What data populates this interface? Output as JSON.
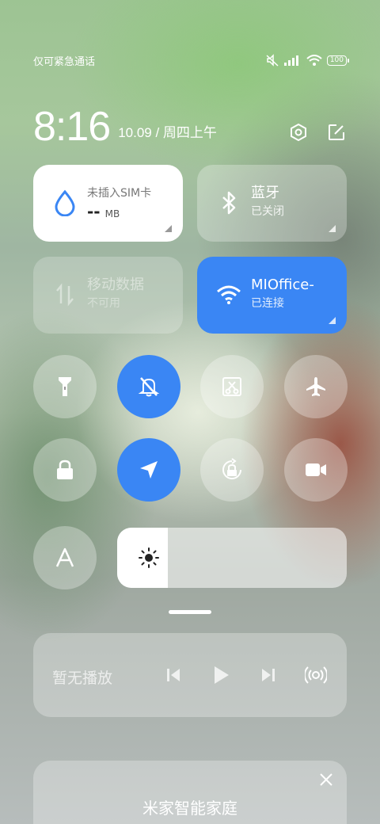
{
  "status_bar": {
    "carrier_text": "仅可紧急通话",
    "battery": "100",
    "icons": [
      "mute-icon",
      "signal-icon",
      "wifi-icon",
      "battery-icon"
    ]
  },
  "clock": {
    "time": "8:16",
    "date": "10.09 / 周四上午",
    "actions": [
      "settings-icon",
      "edit-icon"
    ]
  },
  "tiles": {
    "data_usage": {
      "label": "未插入SIM卡",
      "value": "--",
      "unit": "MB",
      "icon": "water-drop-icon",
      "accent": "#3a86f4"
    },
    "bluetooth": {
      "label": "蓝牙",
      "status": "已关闭",
      "icon": "bluetooth-icon"
    },
    "mobile_data": {
      "label": "移动数据",
      "status": "不可用",
      "icon": "arrows-updown-icon"
    },
    "wifi": {
      "label": "MIOffice-",
      "status": "已连接",
      "icon": "wifi-icon",
      "color": "#3a86f4"
    }
  },
  "toggles": [
    {
      "name": "flashlight",
      "icon": "flashlight-icon",
      "active": false
    },
    {
      "name": "silent",
      "icon": "bell-off-icon",
      "active": true
    },
    {
      "name": "screenshot",
      "icon": "screenshot-icon",
      "active": false
    },
    {
      "name": "airplane",
      "icon": "airplane-icon",
      "active": false
    },
    {
      "name": "lock",
      "icon": "lock-icon",
      "active": false
    },
    {
      "name": "location",
      "icon": "location-icon",
      "active": true
    },
    {
      "name": "rotation-lock",
      "icon": "rotation-lock-icon",
      "active": false
    },
    {
      "name": "screen-recorder",
      "icon": "video-camera-icon",
      "active": false
    },
    {
      "name": "font",
      "icon": "font-a-icon",
      "active": false
    }
  ],
  "brightness": {
    "level": 0.22,
    "icon": "sun-icon"
  },
  "media": {
    "title": "暂无播放",
    "controls": [
      "previous-icon",
      "play-icon",
      "next-icon",
      "cast-icon"
    ]
  },
  "smart_home": {
    "title": "米家智能家庭",
    "close_icon": "close-icon"
  }
}
